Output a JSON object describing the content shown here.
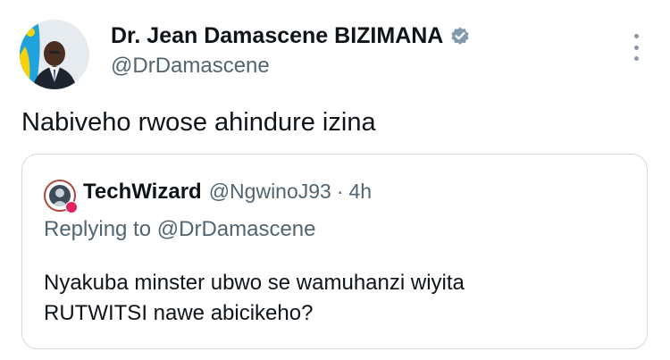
{
  "tweet": {
    "author_name": "Dr. Jean Damascene BIZIMANA",
    "author_handle": "@DrDamascene",
    "verified_icon": "verified-badge-icon",
    "more_icon": "more-options-icon",
    "text": "Nabiveho rwose ahindure izina"
  },
  "quoted": {
    "author_name": "TechWizard",
    "author_handle": "@NgwinoJ93",
    "separator": "·",
    "time": "4h",
    "replying_prefix": "Replying to",
    "replying_mention": "@DrDamascene",
    "text_line1": "Nyakuba minster ubwo se wamuhanzi wiyita",
    "text_line2": "RUTWITSI nawe abicikeho?"
  },
  "colors": {
    "text_primary": "#0f1419",
    "text_secondary": "#536471",
    "verified": "#829aab",
    "border": "#cfd9de",
    "flag_blue": "#20a3dc",
    "flag_yellow": "#f5d20a"
  }
}
